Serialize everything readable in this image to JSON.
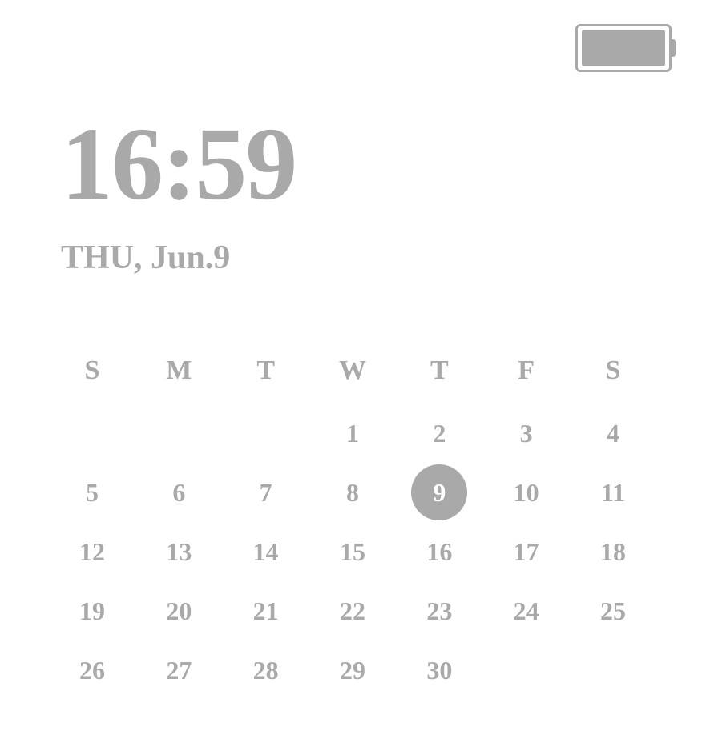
{
  "battery": {
    "level_percent": 100
  },
  "clock": {
    "time": "16:59",
    "date": "THU, Jun.9"
  },
  "calendar": {
    "headers": [
      "S",
      "M",
      "T",
      "W",
      "T",
      "F",
      "S"
    ],
    "today": 9,
    "weeks": [
      [
        "",
        "",
        "",
        "1",
        "2",
        "3",
        "4"
      ],
      [
        "5",
        "6",
        "7",
        "8",
        "9",
        "10",
        "11"
      ],
      [
        "12",
        "13",
        "14",
        "15",
        "16",
        "17",
        "18"
      ],
      [
        "19",
        "20",
        "21",
        "22",
        "23",
        "24",
        "25"
      ],
      [
        "26",
        "27",
        "28",
        "29",
        "30",
        "",
        ""
      ]
    ]
  }
}
